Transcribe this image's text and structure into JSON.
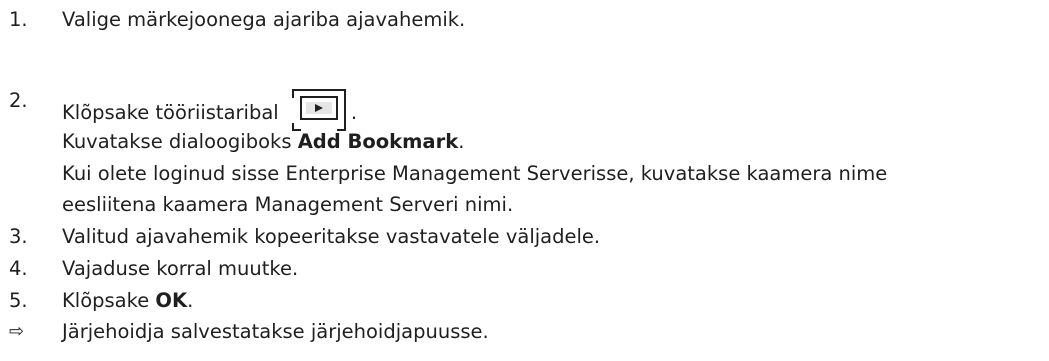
{
  "steps": [
    {
      "num": "1.",
      "text": "Valige märkejoonega ajariba ajavahemik."
    },
    {
      "num": "2.",
      "text": "Klõpsake tööriistaribal",
      "after_icon": ".",
      "icon": "add-bookmark-toolbar-icon",
      "result_prefix": "Kuvatakse dialoogiboks ",
      "result_bold": "Add Bookmark",
      "result_suffix": ".",
      "note_line1": "Kui olete loginud sisse Enterprise Management Serverisse, kuvatakse kaamera nime",
      "note_line2": "eesliitena kaamera Management Serveri nimi."
    },
    {
      "num": "3.",
      "text": "Valitud ajavahemik kopeeritakse vastavatele väljadele."
    },
    {
      "num": "4.",
      "text": "Vajaduse korral muutke."
    },
    {
      "num": "5.",
      "text_prefix": "Klõpsake ",
      "text_bold": "OK",
      "text_suffix": "."
    }
  ],
  "result": {
    "symbol": "⇨",
    "text": "Järjehoidja salvestatakse järjehoidjapuusse."
  }
}
